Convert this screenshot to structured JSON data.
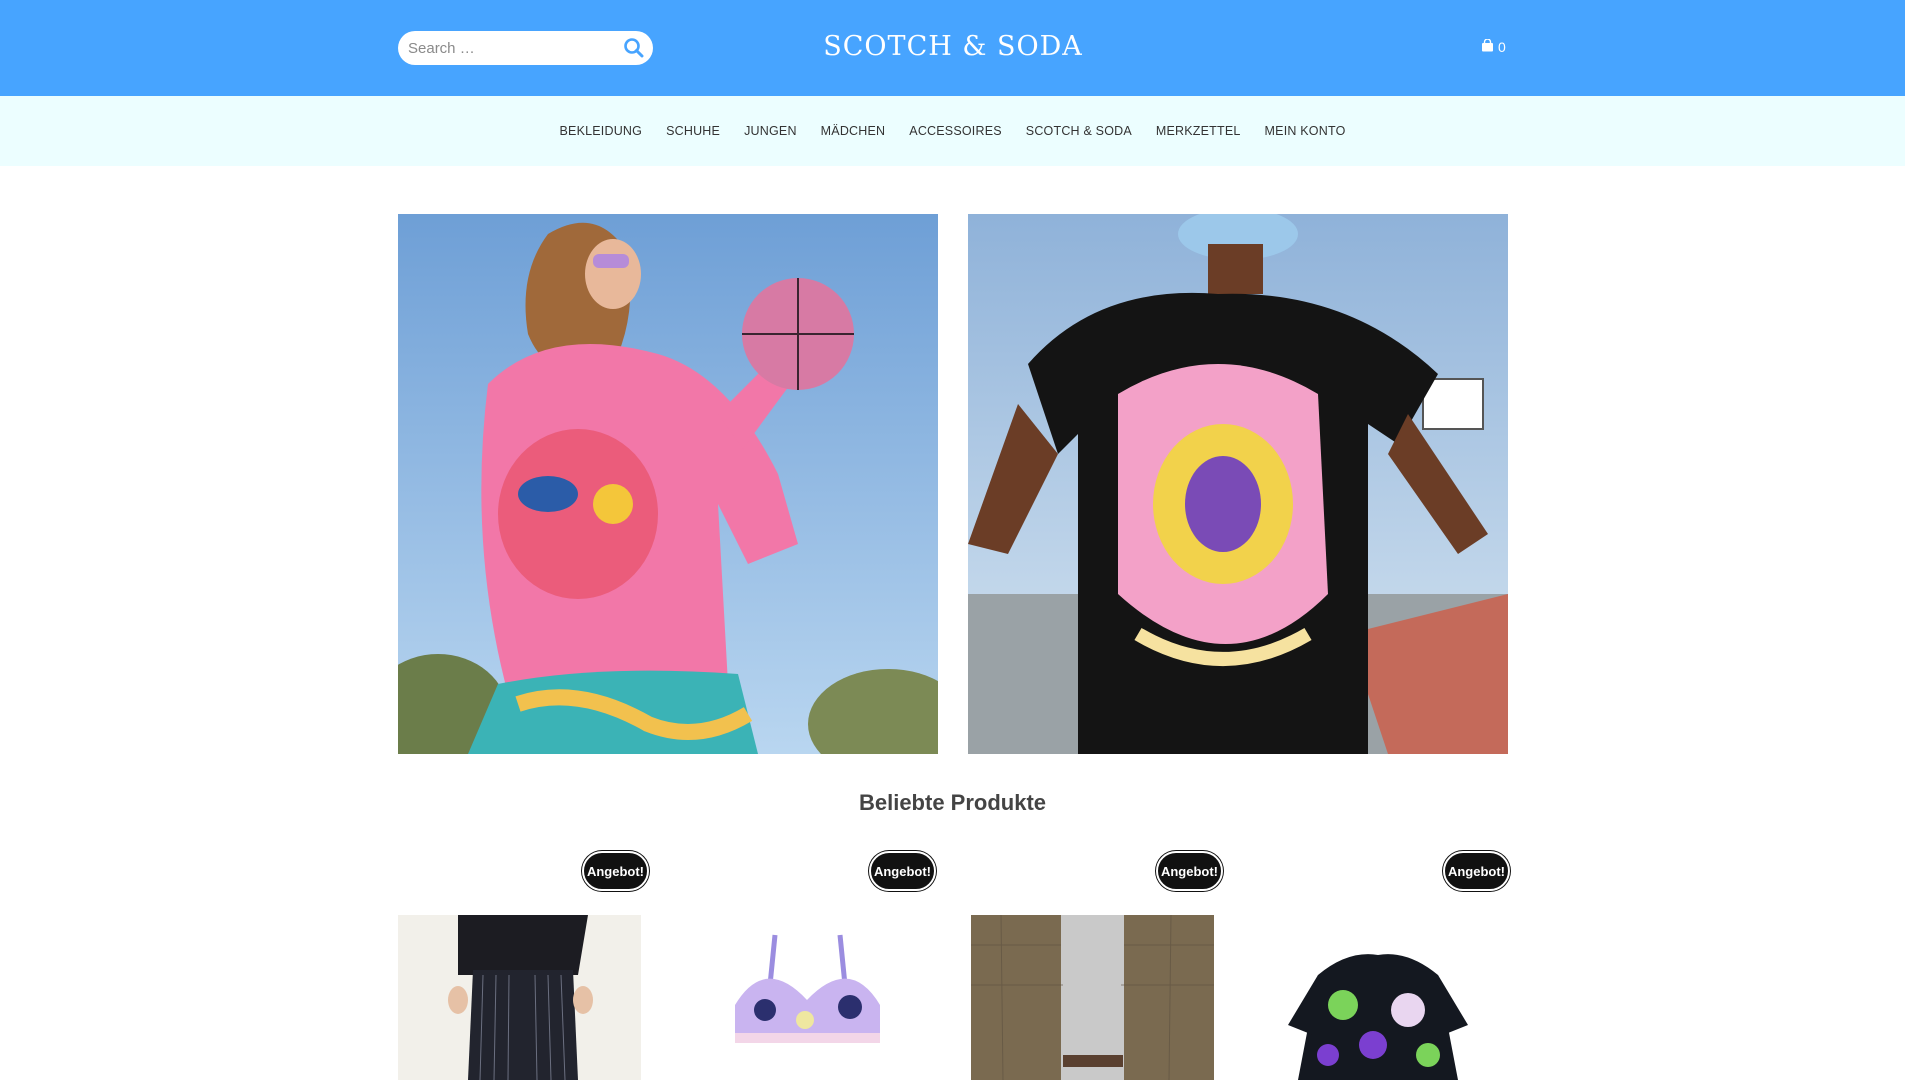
{
  "header": {
    "search_placeholder": "Search …",
    "logo_text": "SCOTCH & SODA",
    "cart_count": "0"
  },
  "nav": {
    "items": [
      {
        "label": "BEKLEIDUNG"
      },
      {
        "label": "SCHUHE"
      },
      {
        "label": "JUNGEN"
      },
      {
        "label": "MÄDCHEN"
      },
      {
        "label": "ACCESSOIRES"
      },
      {
        "label": "SCOTCH & SODA"
      },
      {
        "label": "MERKZETTEL"
      },
      {
        "label": "MEIN KONTO"
      }
    ]
  },
  "section": {
    "title": "Beliebte Produkte"
  },
  "products": [
    {
      "badge": "Angebot!"
    },
    {
      "badge": "Angebot!"
    },
    {
      "badge": "Angebot!"
    },
    {
      "badge": "Angebot!"
    }
  ],
  "colors": {
    "header_bg": "#47a4ff",
    "nav_bg": "#ecfeff",
    "badge_bg": "#111111"
  }
}
